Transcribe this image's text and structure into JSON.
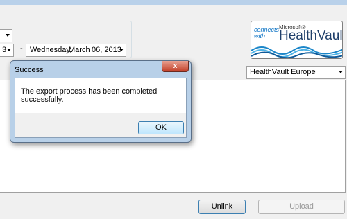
{
  "date_range": {
    "start_fragment": "3",
    "separator": "-",
    "end_day_name": "Wednesday,",
    "end_month": "March",
    "end_day": "06, 2013"
  },
  "logo": {
    "connects": "connects",
    "with": "with",
    "microsoft": "Microsoft®",
    "product": "HealthVault®"
  },
  "region_select": {
    "selected": "HealthVault Europe"
  },
  "buttons": {
    "unlink": "Unlink",
    "upload": "Upload"
  },
  "dialog": {
    "title": "Success",
    "close": "x",
    "message": "The export process has been completed successfully.",
    "ok": "OK"
  }
}
